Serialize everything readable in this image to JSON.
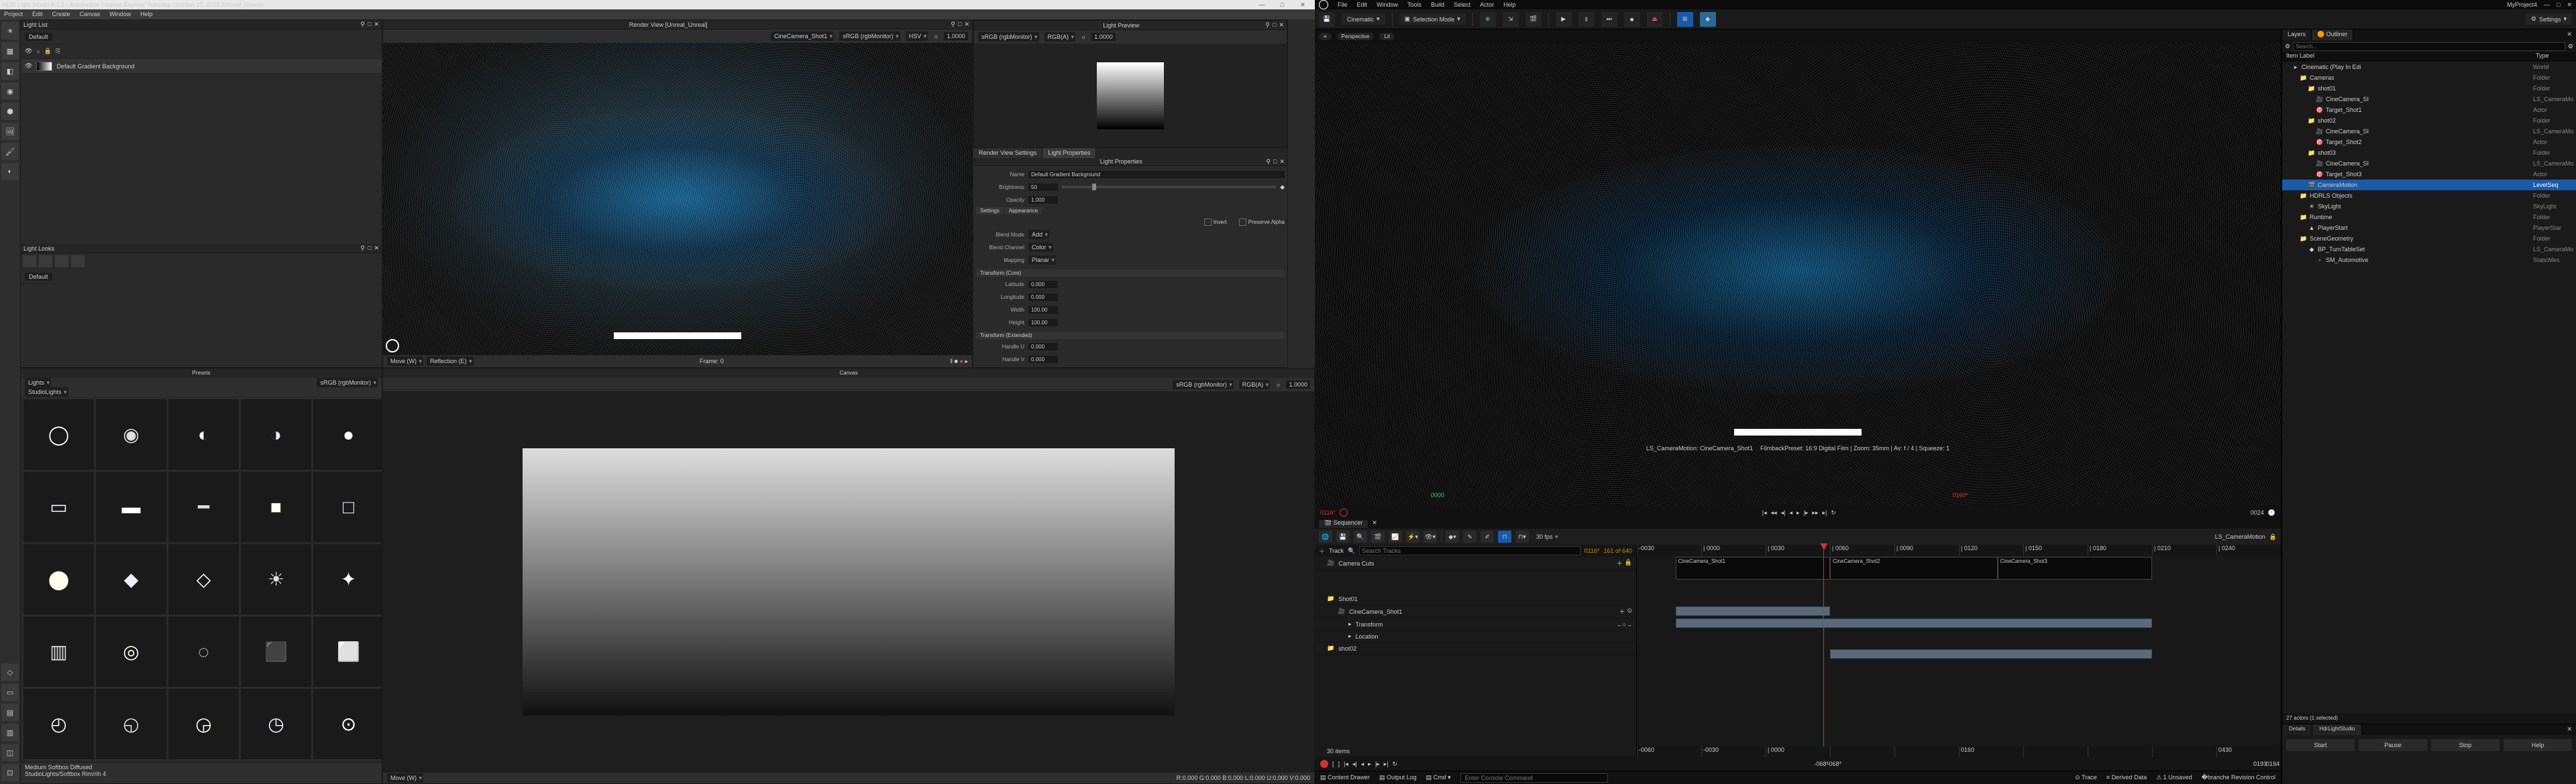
{
  "hls": {
    "title": "HDR Light Studio 8.1.1 - Automotive License Expires: Tuesday, October 17, 2023 [Unreal_Unreal]",
    "menu": [
      "Project",
      "Edit",
      "Create",
      "Canvas",
      "Window",
      "Help"
    ],
    "lightList": {
      "title": "Light List",
      "default_label": "Default",
      "row_name": "Default Gradient Background"
    },
    "lightLooks": {
      "title": "Light Looks",
      "default": "Default"
    },
    "renderView": {
      "title": "Render View [Unreal_Unreal]",
      "camera": "CineCamera_Shot1",
      "colorspace": "sRGB (rgbMonitor)",
      "mode": "HSV",
      "exposure": "1.0000",
      "move": "Move (W)",
      "reflection": "Reflection (E)",
      "frame": "Frame: 0"
    },
    "lightPreview": {
      "title": "Light Preview",
      "cs1": "sRGB (rgbMonitor)",
      "cs2": "RGB(A)",
      "exp": "1.0000"
    },
    "propTabs": {
      "tab1": "Render View Settings",
      "tab2": "Light Properties"
    },
    "props": {
      "header": "Light Properties",
      "name_lbl": "Name",
      "name_val": "Default Gradient Background",
      "brightness_lbl": "Brightness",
      "brightness_val": "50",
      "opacity_lbl": "Opacity",
      "opacity_val": "1.000",
      "settings": "Settings",
      "appearance": "Appearance",
      "invert": "Invert",
      "preserve_alpha": "Preserve Alpha",
      "blend_lbl": "Blend Mode",
      "blend_val": "Add",
      "channel_lbl": "Blend Channel",
      "channel_val": "Color",
      "mapping_lbl": "Mapping",
      "mapping_val": "Planar",
      "tcore": "Transform (Core)",
      "lat_lbl": "Latitude",
      "lat_val": "0.000",
      "lon_lbl": "Longitude",
      "lon_val": "0.000",
      "w_lbl": "Width",
      "w_val": "100.00",
      "h_lbl": "Height",
      "h_val": "100.00",
      "text": "Transform (Extended)",
      "hu_lbl": "Handle U",
      "hu_val": "0.000",
      "hv_lbl": "Handle V",
      "hv_val": "0.000"
    },
    "presets": {
      "title": "Presets",
      "sub_left": "Lights",
      "sub_right": "sRGB (rgbMonitor)",
      "sub2": "StudioLights",
      "foot1": "Medium Softbox Diffused",
      "foot2": "StudioLights/Softbox Rim/rih 4"
    },
    "canvas": {
      "title": "Canvas",
      "cs1": "sRGB (rgbMonitor)",
      "cs2": "RGB(A)",
      "exp": "1.0000",
      "move": "Move (W)",
      "readout": "R:0.000 G:0.000 B:0.000 L:0.000 U:0.000 V:0.000"
    }
  },
  "ue": {
    "menu": [
      "File",
      "Edit",
      "Window",
      "Tools",
      "Build",
      "Select",
      "Actor",
      "Help"
    ],
    "project": "MyProject4",
    "toolbar": {
      "mode": "Cinematic",
      "selmode": "Selection Mode",
      "settings": "Settings"
    },
    "viewbar": {
      "persp": "Perspective",
      "lit": "Lit"
    },
    "overlay": {
      "cam": "LS_CameraMotion: CineCamera_Shot1",
      "filmback": "FilmbackPreset: 16:9 Digital Film | Zoom: 35mm | Av: f / 4 | Squeeze: 1",
      "t_left": "0000",
      "t_play": "0116*",
      "t_rightA": "0024",
      "t_rightB": "0160*"
    },
    "seq": {
      "tab": "Sequencer",
      "fps": "30 fps",
      "name": "LS_CameraMotion",
      "track_btn": "Track",
      "search_ph": "Search Tracks",
      "cur": "0116*",
      "range": "161 of 640",
      "tracks": {
        "camcuts": "Camera Cuts",
        "shot01": "Shot01",
        "cine1": "CineCamera_Shot1",
        "transform": "Transform",
        "location": "Location",
        "shot02": "shot02",
        "items": "30 items"
      },
      "ruler": [
        "-0030",
        "| 0000",
        "| 0030",
        "| 0060",
        "| 0090",
        "| 0120",
        "| 0150",
        "| 0180",
        "| 0210",
        "| 0240"
      ],
      "clips": [
        "CineCamera_Shot1",
        "CineCamera_Shot2",
        "CineCamera_Shot3"
      ],
      "ruler2": [
        "-0060",
        "-0030",
        "| 0000",
        "",
        "",
        "0160",
        "",
        "",
        "",
        "0430"
      ],
      "transport": {
        "l1": "-068*",
        "l2": "-068*",
        "r1": "0193",
        "r2": "0194"
      }
    },
    "status": {
      "drawer": "Content Drawer",
      "log": "Output Log",
      "cmd": "Cmd",
      "cmd_ph": "Enter Console Command",
      "trace": "Trace",
      "derived": "Derived Data",
      "unsaved": "1 Unsaved",
      "rev": "Revision Control"
    },
    "outliner": {
      "tabs": [
        "Layers",
        "Outliner"
      ],
      "search_ph": "Search...",
      "cols": [
        "Item Label",
        "Type"
      ],
      "rows": [
        {
          "i": 1,
          "ic": "▸",
          "name": "Cinematic (Play In Edi",
          "type": "World",
          "cls": ""
        },
        {
          "i": 2,
          "ic": "📁",
          "name": "Cameras",
          "type": "Folder",
          "cls": "fold"
        },
        {
          "i": 3,
          "ic": "📁",
          "name": "shot01",
          "type": "Folder",
          "cls": "fold"
        },
        {
          "i": 4,
          "ic": "🎥",
          "name": "CineCamera_SI",
          "type": "LS_CameraMotion   CineCame",
          "cls": ""
        },
        {
          "i": 4,
          "ic": "🎯",
          "name": "Target_Shot1",
          "type": "Actor",
          "cls": ""
        },
        {
          "i": 3,
          "ic": "📁",
          "name": "shot02",
          "type": "Folder",
          "cls": "fold"
        },
        {
          "i": 4,
          "ic": "🎥",
          "name": "CineCamera_SI",
          "type": "LS_CameraMotion   CineCame",
          "cls": ""
        },
        {
          "i": 4,
          "ic": "🎯",
          "name": "Target_Shot2",
          "type": "Actor",
          "cls": ""
        },
        {
          "i": 3,
          "ic": "📁",
          "name": "shot03",
          "type": "Folder",
          "cls": "fold"
        },
        {
          "i": 4,
          "ic": "🎥",
          "name": "CineCamera_SI",
          "type": "LS_CameraMotion   CineCame",
          "cls": ""
        },
        {
          "i": 4,
          "ic": "🎯",
          "name": "Target_Shot3",
          "type": "Actor",
          "cls": ""
        },
        {
          "i": 3,
          "ic": "🎬",
          "name": "CameraMotion",
          "type": "LevelSeq",
          "cls": "",
          "sel": true
        },
        {
          "i": 2,
          "ic": "📁",
          "name": "HDRLS Objects",
          "type": "Folder",
          "cls": "fold"
        },
        {
          "i": 3,
          "ic": "☀",
          "name": "SkyLight",
          "type": "SkyLight",
          "cls": ""
        },
        {
          "i": 2,
          "ic": "📁",
          "name": "Runtime",
          "type": "Folder",
          "cls": "fold"
        },
        {
          "i": 3,
          "ic": "▲",
          "name": "PlayerStart",
          "type": "PlayerStar",
          "cls": ""
        },
        {
          "i": 2,
          "ic": "📁",
          "name": "SceneGeometry",
          "type": "Folder",
          "cls": "fold"
        },
        {
          "i": 3,
          "ic": "◆",
          "name": "BP_TurnTableSet",
          "type": "LS_CameraMotion   Edit BP_Tu",
          "cls": ""
        },
        {
          "i": 4,
          "ic": "▫",
          "name": "SM_Automotive",
          "type": "StaticMes",
          "cls": ""
        }
      ],
      "foot": "27 actors (1 selected)"
    },
    "details": {
      "tabs": [
        "Details",
        "HdrLightStudio"
      ],
      "btns": [
        "Start",
        "Pause",
        "Stop",
        "Help"
      ]
    }
  }
}
